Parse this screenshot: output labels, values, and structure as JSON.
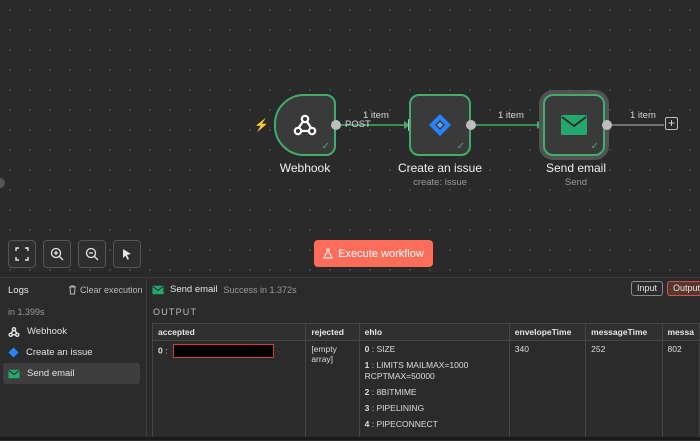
{
  "canvas": {
    "nodes": {
      "webhook": {
        "title": "Webhook",
        "icon": "webhook-icon"
      },
      "jira": {
        "title": "Create an issue",
        "subtitle": "create: issue",
        "icon": "jira-icon"
      },
      "email": {
        "title": "Send email",
        "subtitle": "Send",
        "icon": "email-icon"
      }
    },
    "connections": {
      "webhook_out": "POST",
      "c1": "1 item",
      "c2": "1 item",
      "c3": "1 item"
    },
    "plus": "+",
    "execute_label": "Execute workflow",
    "colors": {
      "accent": "#ff6d5a",
      "success": "#3fae6b",
      "jira": "#2684ff",
      "email": "#23a96e"
    }
  },
  "logs": {
    "title": "Logs",
    "clear_label": "Clear execution",
    "duration": "in 1.399s",
    "items": [
      {
        "label": "Webhook",
        "icon": "webhook-icon"
      },
      {
        "label": "Create an issue",
        "icon": "jira-icon"
      },
      {
        "label": "Send email",
        "icon": "email-icon"
      }
    ]
  },
  "output": {
    "node_name": "Send email",
    "status": "Success in 1.372s",
    "input_tab": "Input",
    "output_tab": "Output",
    "section_label": "OUTPUT",
    "columns": [
      "accepted",
      "rejected",
      "ehlo",
      "envelopeTime",
      "messageTime",
      "messa"
    ],
    "row": {
      "accepted_index": "0",
      "rejected": "[empty array]",
      "ehlo": [
        {
          "index": "0",
          "value": "SIZE"
        },
        {
          "index": "1",
          "value": "LIMITS MAILMAX=1000 RCPTMAX=50000"
        },
        {
          "index": "2",
          "value": "8BITMIME"
        },
        {
          "index": "3",
          "value": "PIPELINING"
        },
        {
          "index": "4",
          "value": "PIPECONNECT"
        }
      ],
      "envelopeTime": "340",
      "messageTime": "252",
      "messageSize": "802"
    }
  }
}
